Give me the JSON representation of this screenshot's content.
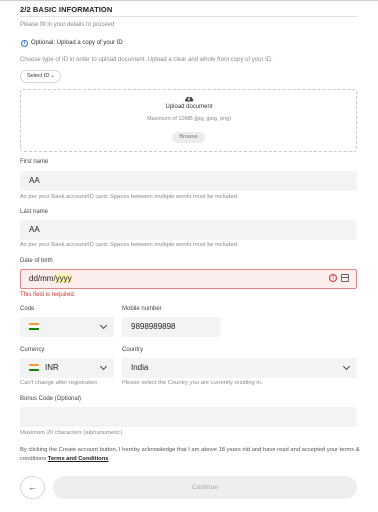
{
  "form": {
    "title": "2/2 BASIC INFORMATION",
    "subtitle": "Please fill in your details to proceed",
    "info_icon": "info-icon",
    "upload_notice": "Optional: Upload a copy of your ID",
    "choose_text": "Choose type of ID in order to upload document. Upload a clear and whole front copy of your ID.",
    "select_id_label": "Select ID",
    "upload": {
      "icon": "cloud-upload-icon",
      "title": "Upload document",
      "size_text": "Maximum of 10MB (jpg, jpeg, png)",
      "browse_label": "Browse"
    },
    "first_name": {
      "label": "First name",
      "value": "AA",
      "hint": "As per your Bank account/ID card. Spaces between multiple words must be included."
    },
    "last_name": {
      "label": "Last name",
      "value": "AA",
      "hint": "As per your Bank account/ID card. Spaces between multiple words must be included."
    },
    "dob": {
      "label": "Date of birth",
      "value_prefix": "dd/mm/",
      "value_highlight": "yyyy",
      "error": "This field is required."
    },
    "code": {
      "label": "Code",
      "flag_icon": "india-flag-icon"
    },
    "mobile": {
      "label": "Mobile number",
      "value": "9898989898"
    },
    "currency": {
      "label": "Currency",
      "value": "INR",
      "flag_icon": "india-flag-icon",
      "hint": "Can't change after registration."
    },
    "country": {
      "label": "Country",
      "value": "India",
      "hint": "Please select the Country you are currently residing in."
    },
    "bonus": {
      "label": "Bonus Code (Optional)",
      "value": "",
      "hint": "Maximum 20 characters (alphanumeric)"
    },
    "terms_text": "By clicking the Create account button, I hereby acknowledge that I am above 18 years old and have read and accepted your terms & conditions ",
    "terms_link": "Terms and Conditions",
    "back_icon": "arrow-left-icon",
    "back_glyph": "←",
    "continue_label": "Continue"
  },
  "colors": {
    "error": "#d93025",
    "accent": "#2f6fd6",
    "input_bg": "#f3f3f3",
    "flag_saffron": "#ff9933",
    "flag_green": "#138808"
  }
}
